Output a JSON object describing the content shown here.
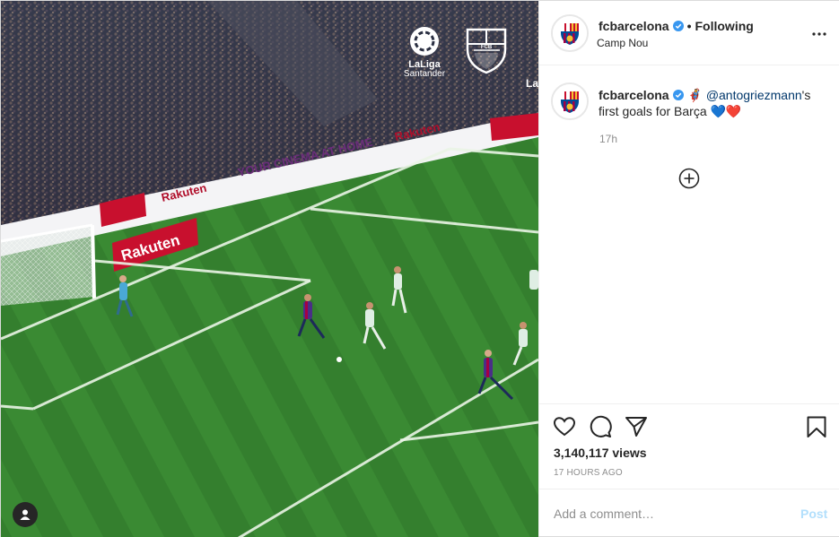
{
  "video": {
    "overlay": {
      "league_logo_text_1": "LaLiga",
      "league_logo_text_2": "Santander",
      "club_crest_text": "FCB",
      "corner_text": "La"
    },
    "ad_boards": {
      "rakuten": "Rakuten",
      "cinema": "YOUR CINEMA AT HOME",
      "small": "TV"
    }
  },
  "header": {
    "username": "fcbarcelona",
    "separator": "•",
    "follow_label": "Following",
    "location": "Camp Nou"
  },
  "caption": {
    "username": "fcbarcelona",
    "text_1": " 🦸 ",
    "mention": "@antogriezmann",
    "text_2": "'s first goals for Barça ",
    "hearts": "💙❤️",
    "time": "17h"
  },
  "stats": {
    "views": "3,140,117 views",
    "posted": "17 HOURS AGO"
  },
  "comment": {
    "placeholder": "Add a comment…",
    "post_label": "Post"
  },
  "icons": {
    "like": "heart-icon",
    "comment": "comment-icon",
    "share": "paper-plane-icon",
    "save": "bookmark-icon",
    "more": "more-options-icon",
    "load_more": "plus-circle-icon",
    "user_tags": "user-icon",
    "verified": "verified-badge-icon"
  },
  "colors": {
    "accent_blue": "#3897f0",
    "mention": "#00376b",
    "muted": "#8e8e8e",
    "post_disabled": "#b2dffc",
    "barca_blue": "#004d98",
    "barca_red": "#a50044"
  }
}
